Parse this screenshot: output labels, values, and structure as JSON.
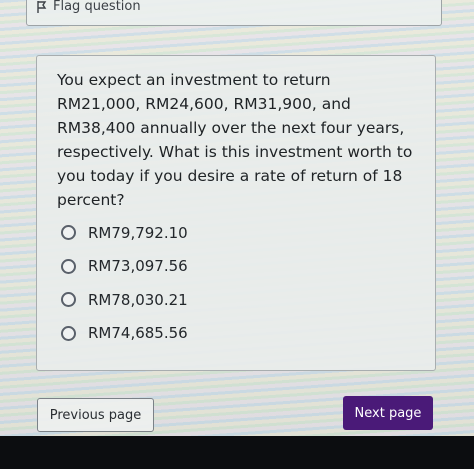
{
  "flag": {
    "label": "Flag question",
    "icon": "flag-icon"
  },
  "question": {
    "text": "You expect an investment to return RM21,000, RM24,600, RM31,900, and RM38,400 annually over the next four years, respectively. What is this investment worth to you today if you desire a rate of return of 18 percent?",
    "options": [
      {
        "label": "RM79,792.10"
      },
      {
        "label": "RM73,097.56"
      },
      {
        "label": "RM78,030.21"
      },
      {
        "label": "RM74,685.56"
      }
    ]
  },
  "navigation": {
    "previous_label": "Previous page",
    "next_label": "Next page"
  },
  "colors": {
    "accent": "#4a1a78",
    "text": "#1f2326"
  }
}
